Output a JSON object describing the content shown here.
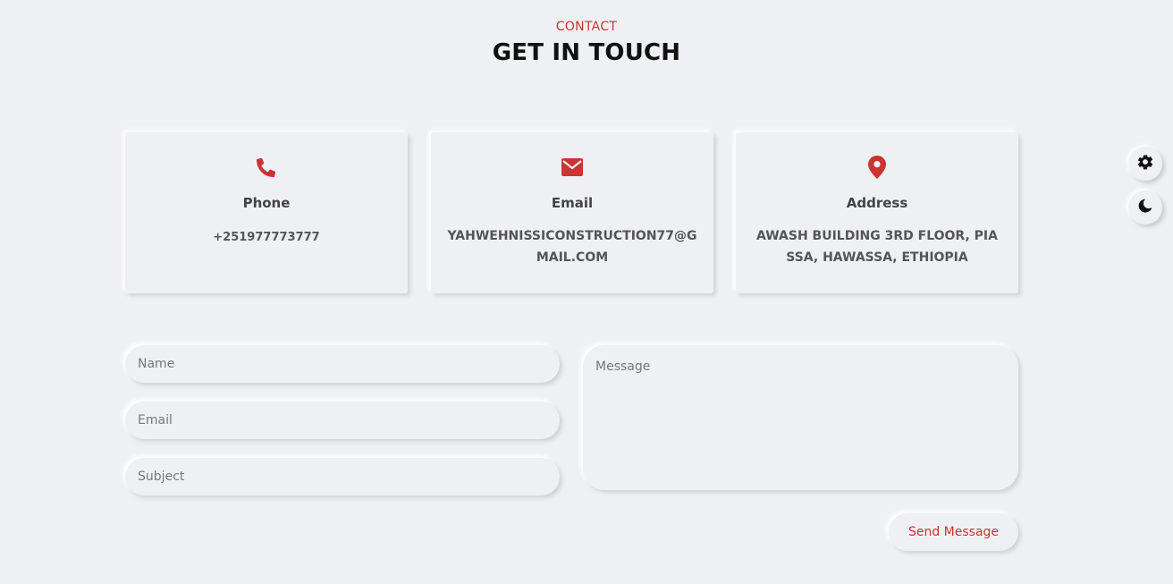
{
  "header": {
    "eyebrow": "CONTACT",
    "title": "GET IN TOUCH"
  },
  "colors": {
    "accent": "#cc3333",
    "background": "#eff0f4"
  },
  "cards": [
    {
      "icon": "phone-icon",
      "label": "Phone",
      "value": "+251977773777"
    },
    {
      "icon": "envelope-icon",
      "label": "Email",
      "value": "YAHWEHNISSICONSTRUCTION77@GMAIL.COM"
    },
    {
      "icon": "map-pin-icon",
      "label": "Address",
      "value": "AWASH BUILDING 3RD FLOOR, PIASSA, HAWASSA, ETHIOPIA"
    }
  ],
  "form": {
    "name_placeholder": "Name",
    "email_placeholder": "Email",
    "subject_placeholder": "Subject",
    "message_placeholder": "Message",
    "submit_label": "Send Message"
  },
  "side_buttons": [
    {
      "icon": "gear-icon"
    },
    {
      "icon": "moon-icon"
    }
  ]
}
